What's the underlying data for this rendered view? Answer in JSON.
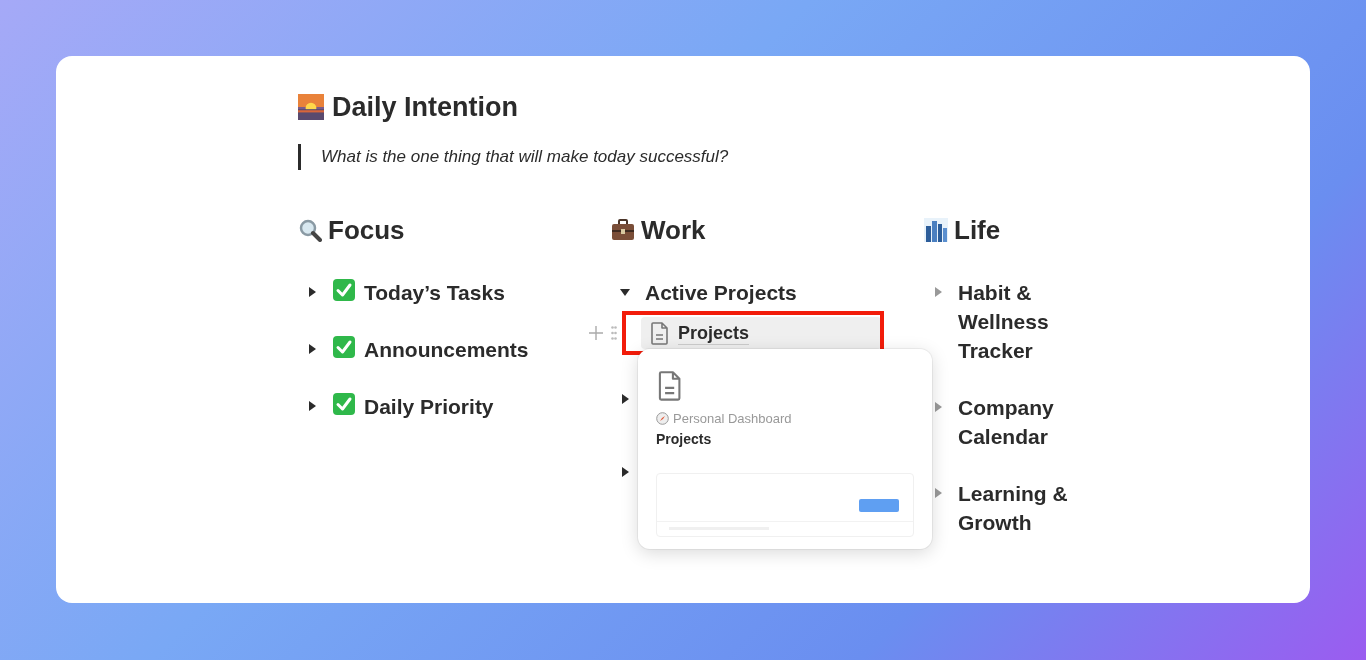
{
  "heading": {
    "title": "Daily Intention",
    "quote": "What is the one thing that will make today successful?"
  },
  "columns": [
    {
      "title": "Focus",
      "items": [
        {
          "label": "Today’s Tasks",
          "expanded": false
        },
        {
          "label": "Announcements",
          "expanded": false
        },
        {
          "label": "Daily Priority",
          "expanded": false
        }
      ]
    },
    {
      "title": "Work",
      "items": [
        {
          "label": "Active Projects",
          "expanded": true,
          "children": [
            {
              "label": "Projects",
              "hovered": true
            }
          ]
        },
        {
          "expanded": false
        },
        {
          "expanded": false
        }
      ]
    },
    {
      "title": "Life",
      "items": [
        {
          "label": "Habit & Wellness Tracker",
          "expanded": false
        },
        {
          "label": "Company Calendar",
          "expanded": false
        },
        {
          "label": "Learning & Growth",
          "expanded": false
        }
      ]
    }
  ],
  "preview": {
    "breadcrumb": "Personal Dashboard",
    "title": "Projects"
  }
}
